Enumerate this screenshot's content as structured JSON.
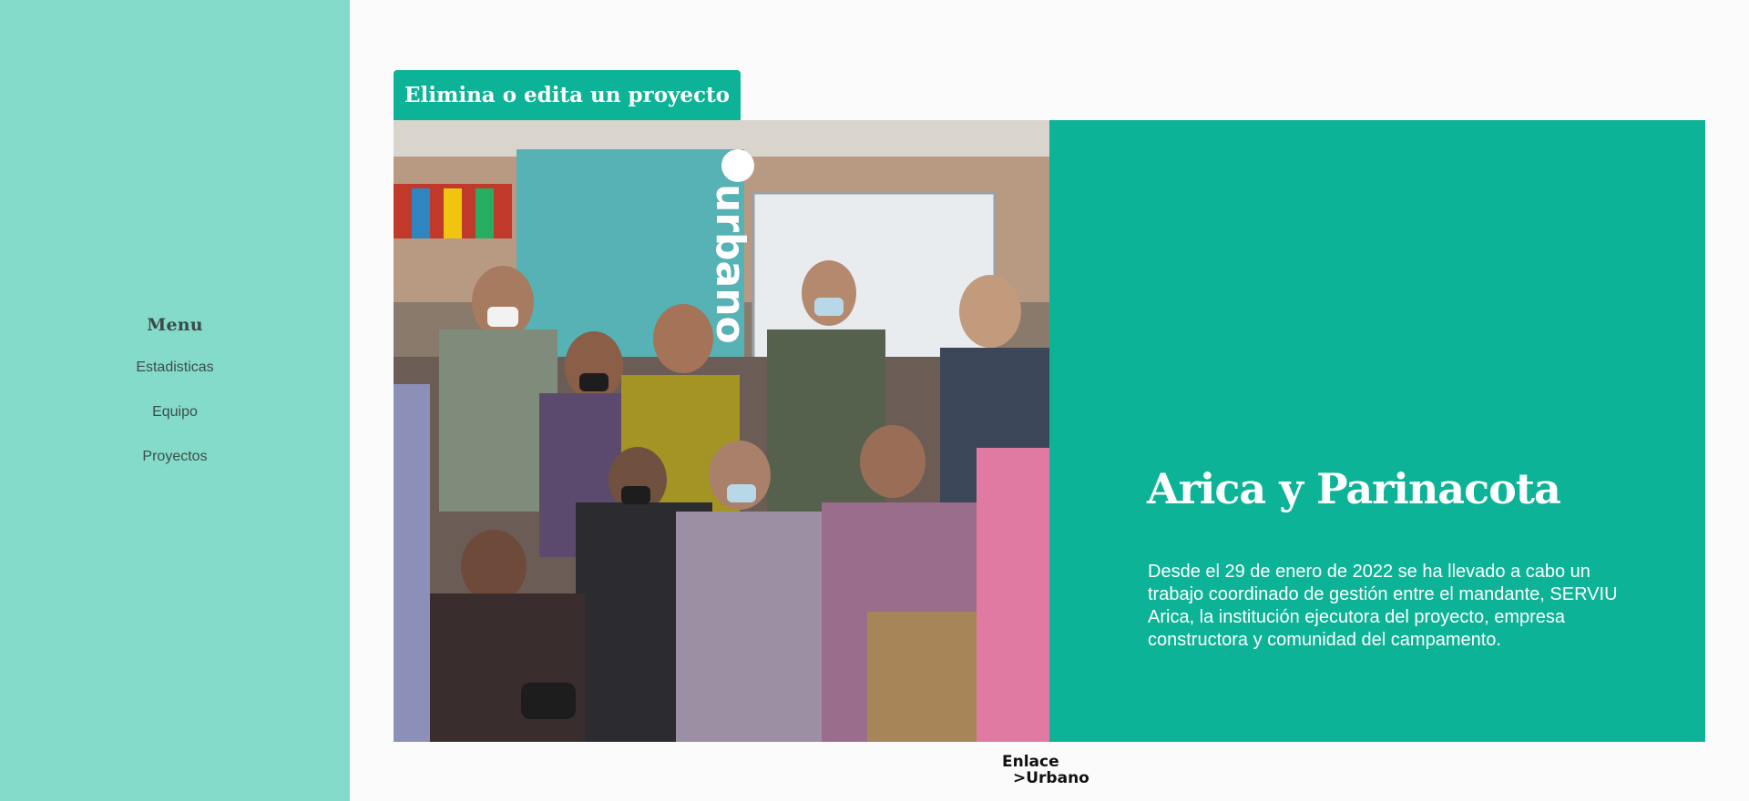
{
  "sidebar": {
    "title": "Menu",
    "items": [
      {
        "label": "Estadisticas"
      },
      {
        "label": "Equipo"
      },
      {
        "label": "Proyectos"
      }
    ]
  },
  "main": {
    "edit_button_label": "Elimina o edita un proyecto",
    "project": {
      "title": "Arica y Parinacota",
      "description": "Desde el 29 de enero de 2022 se ha llevado a cabo un trabajo coordinado de gestión entre el mandante, SERVIU Arica, la institución ejecutora del proyecto, empresa constructora y comunidad del campamento.",
      "photo_banner_text": "urbano"
    }
  },
  "footer": {
    "logo_line1": "Enlace",
    "logo_line2": ">Urbano"
  },
  "colors": {
    "sidebar_bg": "#84dbc9",
    "accent": "#0cb397",
    "page_bg": "#fbfbfb",
    "text_dark": "#3e4d4a"
  }
}
